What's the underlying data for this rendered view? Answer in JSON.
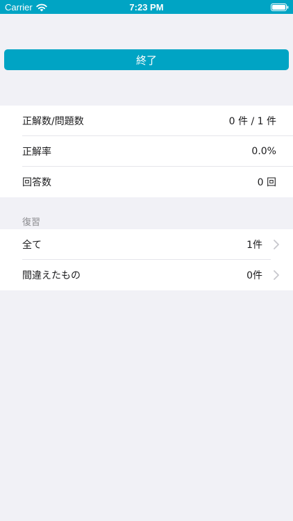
{
  "status_bar": {
    "carrier": "Carrier",
    "time": "7:23 PM",
    "icons": [
      "wifi-icon",
      "battery-icon"
    ]
  },
  "colors": {
    "accent": "#00a4c4",
    "background": "#f1f1f6",
    "cell": "#ffffff",
    "section_header": "#8a8a8e",
    "chevron": "#c7c7cc"
  },
  "finish_button": {
    "label": "終了"
  },
  "stats": [
    {
      "label": "正解数/問題数",
      "value": "0 件 / 1 件"
    },
    {
      "label": "正解率",
      "value": "0.0%"
    },
    {
      "label": "回答数",
      "value": "0 回"
    }
  ],
  "review": {
    "header": "復習",
    "items": [
      {
        "label": "全て",
        "value": "1件",
        "icon": "chevron-right-icon"
      },
      {
        "label": "間違えたもの",
        "value": "0件",
        "icon": "chevron-right-icon"
      }
    ]
  }
}
